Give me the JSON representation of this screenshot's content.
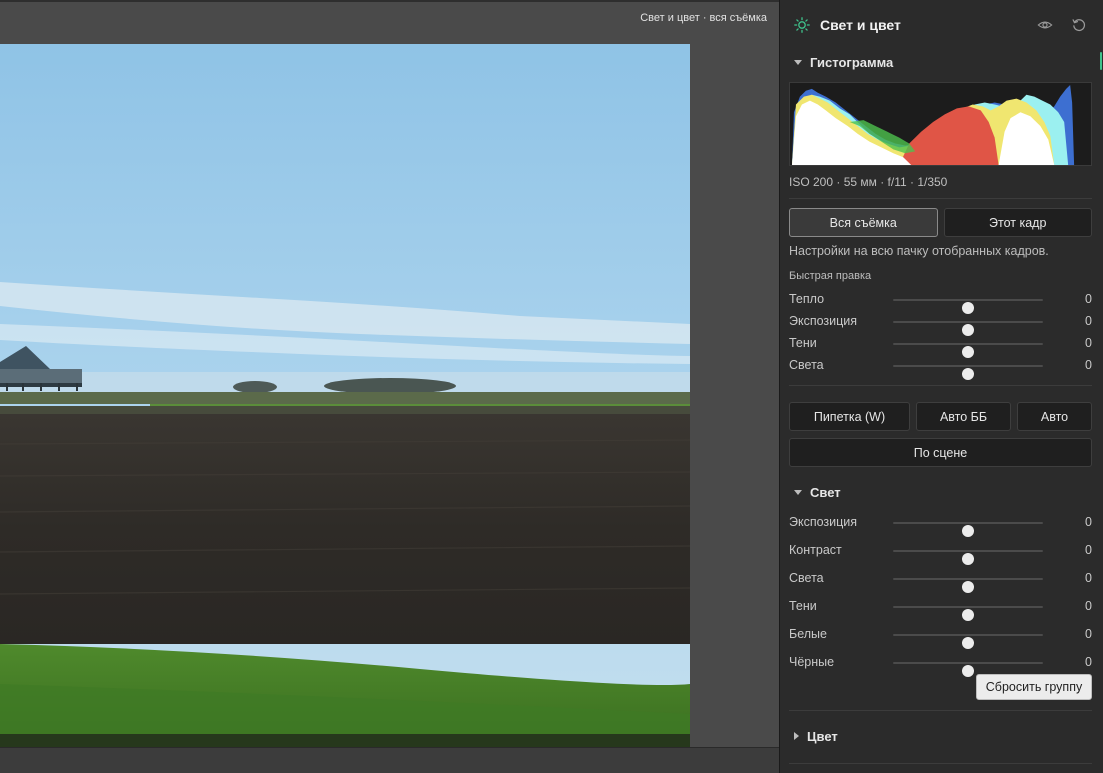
{
  "viewer": {
    "caption": "Свет и цвет · вся съёмка"
  },
  "panel": {
    "title": "Свет и цвет",
    "icons": [
      "sun-icon",
      "eye-icon",
      "reset-icon"
    ],
    "histogram": {
      "title": "Гистограмма",
      "exif": "ISO 200 · 55 мм · f/11 · 1/350"
    },
    "scope": {
      "options": [
        "Вся съёмка",
        "Этот кадр"
      ],
      "selected": "Вся съёмка",
      "description": "Настройки на всю пачку отобранных кадров."
    },
    "quick_edit": {
      "label": "Быстрая правка",
      "sliders": [
        {
          "label": "Тепло",
          "value": "0",
          "position": 0.5
        },
        {
          "label": "Экспозиция",
          "value": "0",
          "position": 0.5
        },
        {
          "label": "Тени",
          "value": "0",
          "position": 0.5
        },
        {
          "label": "Света",
          "value": "0",
          "position": 0.5
        }
      ]
    },
    "auto_buttons": {
      "eyedropper": "Пипетка (W)",
      "auto_wb": "Авто ББ",
      "auto": "Авто",
      "by_scene": "По сцене"
    },
    "light_group": {
      "title": "Свет",
      "expanded": true,
      "sliders": [
        {
          "label": "Экспозиция",
          "value": "0",
          "position": 0.5
        },
        {
          "label": "Контраст",
          "value": "0",
          "position": 0.5
        },
        {
          "label": "Света",
          "value": "0",
          "position": 0.5
        },
        {
          "label": "Тени",
          "value": "0",
          "position": 0.5
        },
        {
          "label": "Белые",
          "value": "0",
          "position": 0.5
        },
        {
          "label": "Чёрные",
          "value": "0",
          "position": 0.5
        }
      ],
      "reset_label": "Сбросить группу"
    },
    "color_group": {
      "title": "Цвет",
      "expanded": false
    }
  },
  "colors": {
    "panel_bg": "#2b2b2b",
    "viewer_bg": "#4a4a4a",
    "accent": "#3fc38c"
  }
}
